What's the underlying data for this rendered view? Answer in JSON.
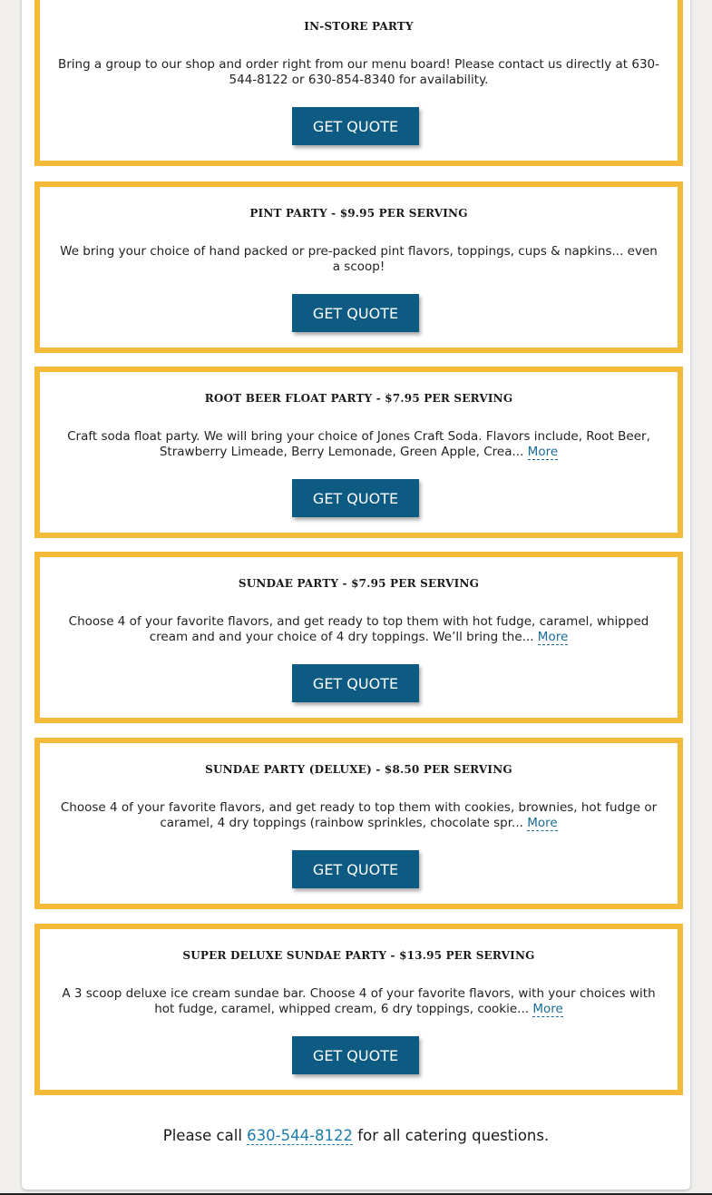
{
  "parties": [
    {
      "title": "IN-STORE PARTY",
      "desc": "Bring a group to our shop and order right from our menu board! Please contact us directly at 630-544-8122 or 630-854-8340 for availability.",
      "more": "",
      "button": "GET QUOTE"
    },
    {
      "title": "PINT PARTY - $9.95 PER SERVING",
      "desc": "We bring your choice of hand packed or pre-packed pint flavors, toppings, cups & napkins... even a scoop!",
      "more": "",
      "button": "GET QUOTE"
    },
    {
      "title": "ROOT BEER FLOAT PARTY - $7.95 PER SERVING",
      "desc": "Craft soda float party. We will bring your choice of Jones Craft Soda. Flavors include, Root Beer, Strawberry Limeade, Berry Lemonade, Green Apple, Crea... ",
      "more": "More",
      "button": "GET QUOTE"
    },
    {
      "title": "SUNDAE PARTY - $7.95 PER SERVING",
      "desc": "Choose 4 of your favorite flavors, and get ready to top them with hot fudge, caramel, whipped cream and and your choice of 4 dry toppings. We’ll bring the... ",
      "more": "More",
      "button": "GET QUOTE"
    },
    {
      "title": "SUNDAE PARTY (DELUXE) - $8.50 PER SERVING",
      "desc": "Choose 4 of your favorite flavors, and get ready to top them with cookies, brownies, hot fudge or caramel, 4 dry toppings (rainbow sprinkles, chocolate spr... ",
      "more": "More",
      "button": "GET QUOTE"
    },
    {
      "title": "SUPER DELUXE SUNDAE PARTY - $13.95 PER SERVING",
      "desc": "A 3 scoop deluxe ice cream sundae bar. Choose 4 of your favorite flavors, with your choices with hot fudge, caramel, whipped cream, 6 dry toppings, cookie... ",
      "more": "More",
      "button": "GET QUOTE"
    }
  ],
  "footer": {
    "prefix": "Please call ",
    "phone": "630-544-8122",
    "suffix": " for all catering questions."
  },
  "colors": {
    "border": "#f4b938",
    "button": "#0d5a82",
    "link": "#1a7ca8"
  }
}
